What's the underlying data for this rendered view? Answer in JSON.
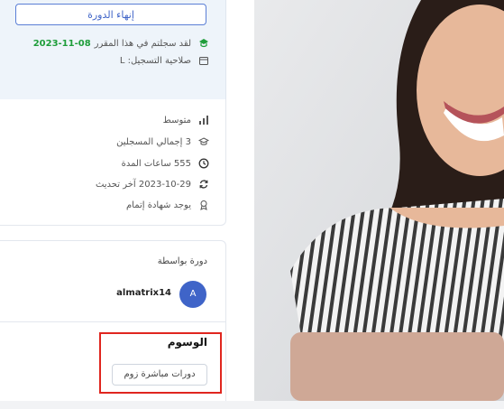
{
  "enroll_card": {
    "finish_button": "إنهاء الدورة",
    "enrolled_text": "لقد سجلتم في هذا المقرر",
    "enrolled_date": "2023-11-08",
    "validity_text": "صلاحية التسجيل: L"
  },
  "meta": {
    "level": "متوسط",
    "students": "3 إجمالي المسجلين",
    "duration": "555 ساعات  المدة",
    "updated": "2023-10-29 آخر تحديث",
    "certificate": "يوجد شهادة إتمام"
  },
  "author": {
    "title": "دورة بواسطة",
    "avatar_initial": "A",
    "name": "almatrix14"
  },
  "tags": {
    "title": "الوسوم",
    "items": [
      "دورات مباشرة زوم"
    ]
  },
  "colors": {
    "accent": "#3f64c8",
    "success": "#1e9d3a",
    "highlight_border": "#e0261f"
  }
}
